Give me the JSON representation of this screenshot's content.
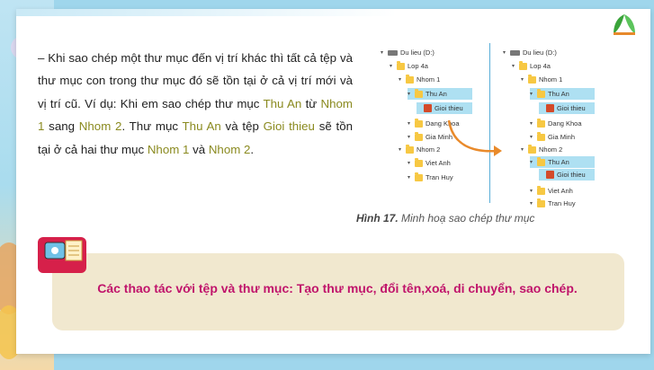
{
  "paragraph": {
    "lead": "– Khi sao chép một thư mục đến vị trí khác thì tất cả tệp và thư mục con trong thư mục đó sẽ tồn tại ở cả vị trí mới và vị trí cũ. Ví dụ: Khi em sao chép thư mục ",
    "thu_an_1": "Thu An",
    "t2": " từ ",
    "nhom1_1": "Nhom 1",
    "t3": " sang ",
    "nhom2_1": "Nhom 2",
    "t4": ". Thư mục ",
    "thu_an_2": "Thu An",
    "t5": " và tệp ",
    "gioi_thieu": "Gioi thieu",
    "t6": " sẽ tồn tại ở cả hai thư mục ",
    "nhom1_2": "Nhom 1",
    "t7": " và ",
    "nhom2_2": "Nhom 2",
    "t8": "."
  },
  "figure": {
    "left": [
      {
        "label": "Du lieu (D:)",
        "type": "drive"
      },
      {
        "label": "Lop 4a",
        "type": "folder"
      },
      {
        "label": "Nhom 1",
        "type": "folder"
      },
      {
        "label": "Thu An",
        "type": "folder"
      },
      {
        "label": "Gioi thieu",
        "type": "ppt"
      },
      {
        "label": "Dang Khoa",
        "type": "folder"
      },
      {
        "label": "Gia Minh",
        "type": "folder"
      },
      {
        "label": "Nhom 2",
        "type": "folder"
      },
      {
        "label": "Viet Anh",
        "type": "folder"
      },
      {
        "label": "Tran Huy",
        "type": "folder"
      }
    ],
    "right": [
      {
        "label": "Du lieu (D:)",
        "type": "drive"
      },
      {
        "label": "Lop 4a",
        "type": "folder"
      },
      {
        "label": "Nhom 1",
        "type": "folder"
      },
      {
        "label": "Thu An",
        "type": "folder"
      },
      {
        "label": "Gioi thieu",
        "type": "ppt"
      },
      {
        "label": "Dang Khoa",
        "type": "folder"
      },
      {
        "label": "Gia Minh",
        "type": "folder"
      },
      {
        "label": "Nhom 2",
        "type": "folder"
      },
      {
        "label": "Thu An",
        "type": "folder"
      },
      {
        "label": "Gioi thieu",
        "type": "ppt"
      },
      {
        "label": "Viet Anh",
        "type": "folder"
      },
      {
        "label": "Tran Huy",
        "type": "folder"
      }
    ],
    "caption_bold": "Hình 17.",
    "caption_rest": " Minh hoạ sao chép thư mục"
  },
  "summary": {
    "text": "Các thao tác với tệp và thư mục: Tạo thư mục, đổi tên,xoá, di chuyển, sao chép."
  },
  "colors": {
    "highlight": "#8a8a1f",
    "summary_text": "#c0146b",
    "summary_bg": "#f1e8cf",
    "arrow": "#e98a2b"
  },
  "icons": [
    "logo-icon",
    "drive-icon",
    "folder-icon",
    "ppt-file-icon",
    "tip-icon",
    "copy-arrow-icon"
  ]
}
